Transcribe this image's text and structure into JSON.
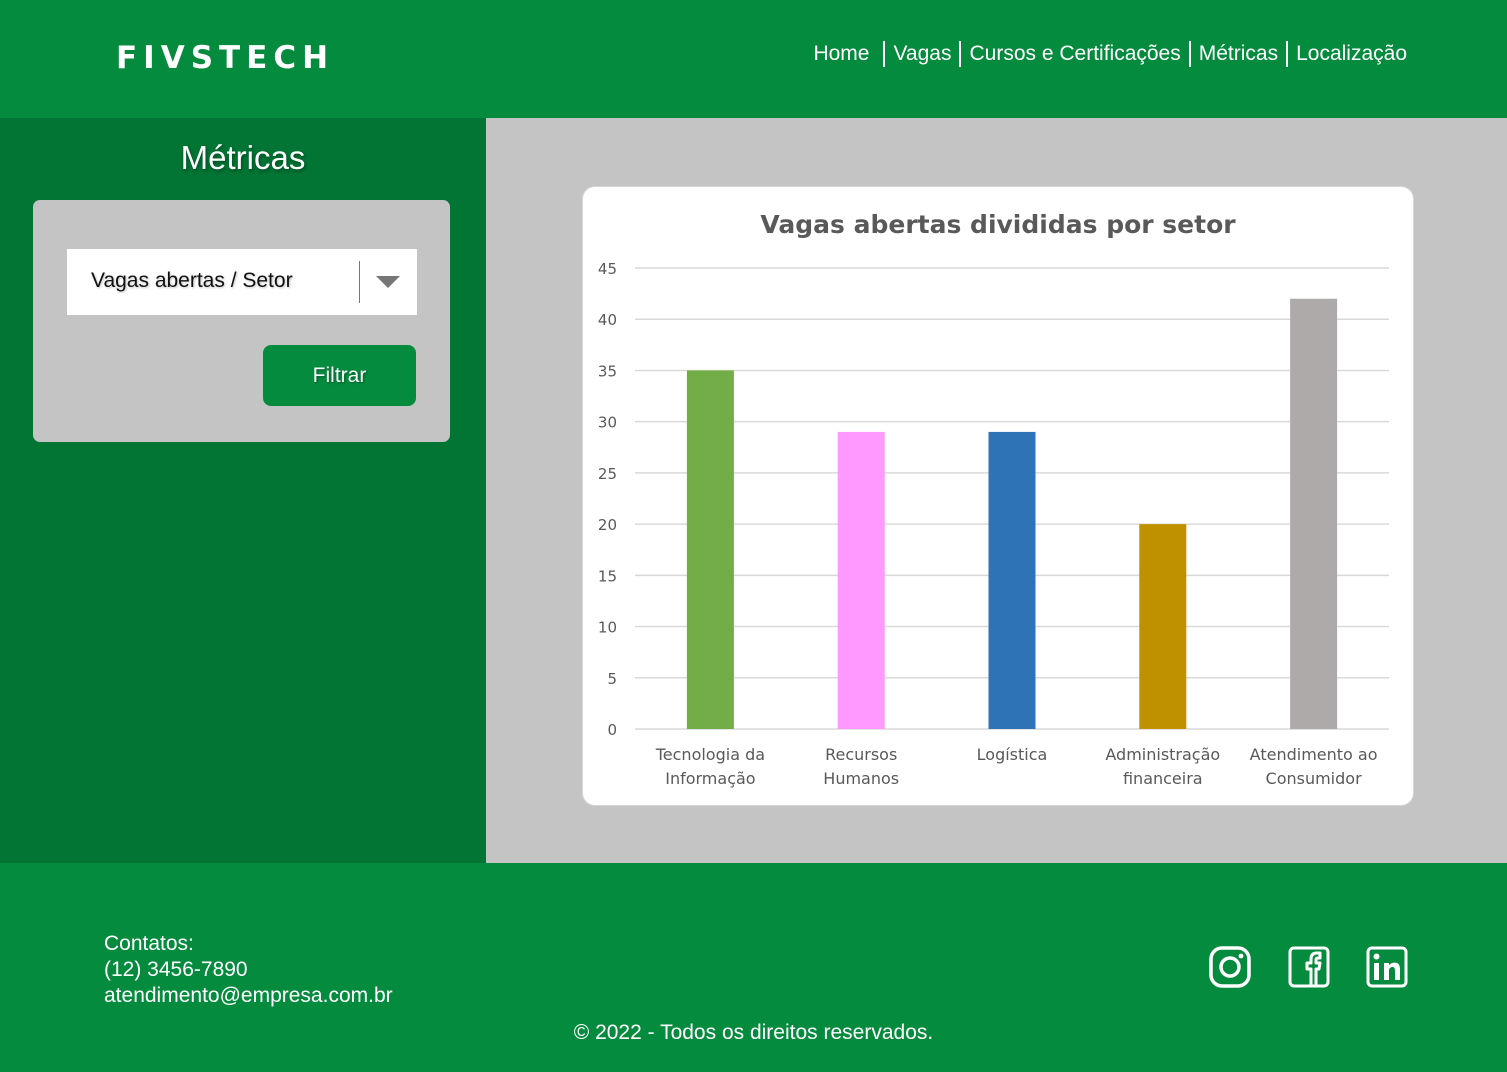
{
  "header": {
    "logo": "FIVSTECH",
    "nav": [
      "Home",
      "Vagas",
      "Cursos e Certificações",
      "Métricas",
      "Localização"
    ]
  },
  "sidebar": {
    "title": "Métricas",
    "select": {
      "value": "Vagas abertas / Setor"
    },
    "filter_button": "Filtrar"
  },
  "chart_data": {
    "type": "bar",
    "title": "Vagas abertas divididas por setor",
    "xlabel": "",
    "ylabel": "",
    "categories": [
      [
        "Tecnologia da",
        "Informação"
      ],
      [
        "Recursos",
        "Humanos"
      ],
      [
        "Logística"
      ],
      [
        "Administração",
        "financeira"
      ],
      [
        "Atendimento ao",
        "Consumidor"
      ]
    ],
    "values": [
      35,
      29,
      29,
      20,
      42
    ],
    "colors": [
      "#72ad47",
      "#ff99ff",
      "#2e73b5",
      "#bf9000",
      "#aeaaaa"
    ],
    "ylim": [
      0,
      45
    ],
    "yticks": [
      0,
      5,
      10,
      15,
      20,
      25,
      30,
      35,
      40,
      45
    ],
    "grid": true
  },
  "footer": {
    "contacts_label": "Contatos:",
    "phone": "(12) 3456-7890",
    "email": "atendimento@empresa.com.br",
    "copyright": "© 2022 - Todos os direitos reservados.",
    "social": [
      "instagram-icon",
      "facebook-icon",
      "linkedin-icon"
    ]
  }
}
